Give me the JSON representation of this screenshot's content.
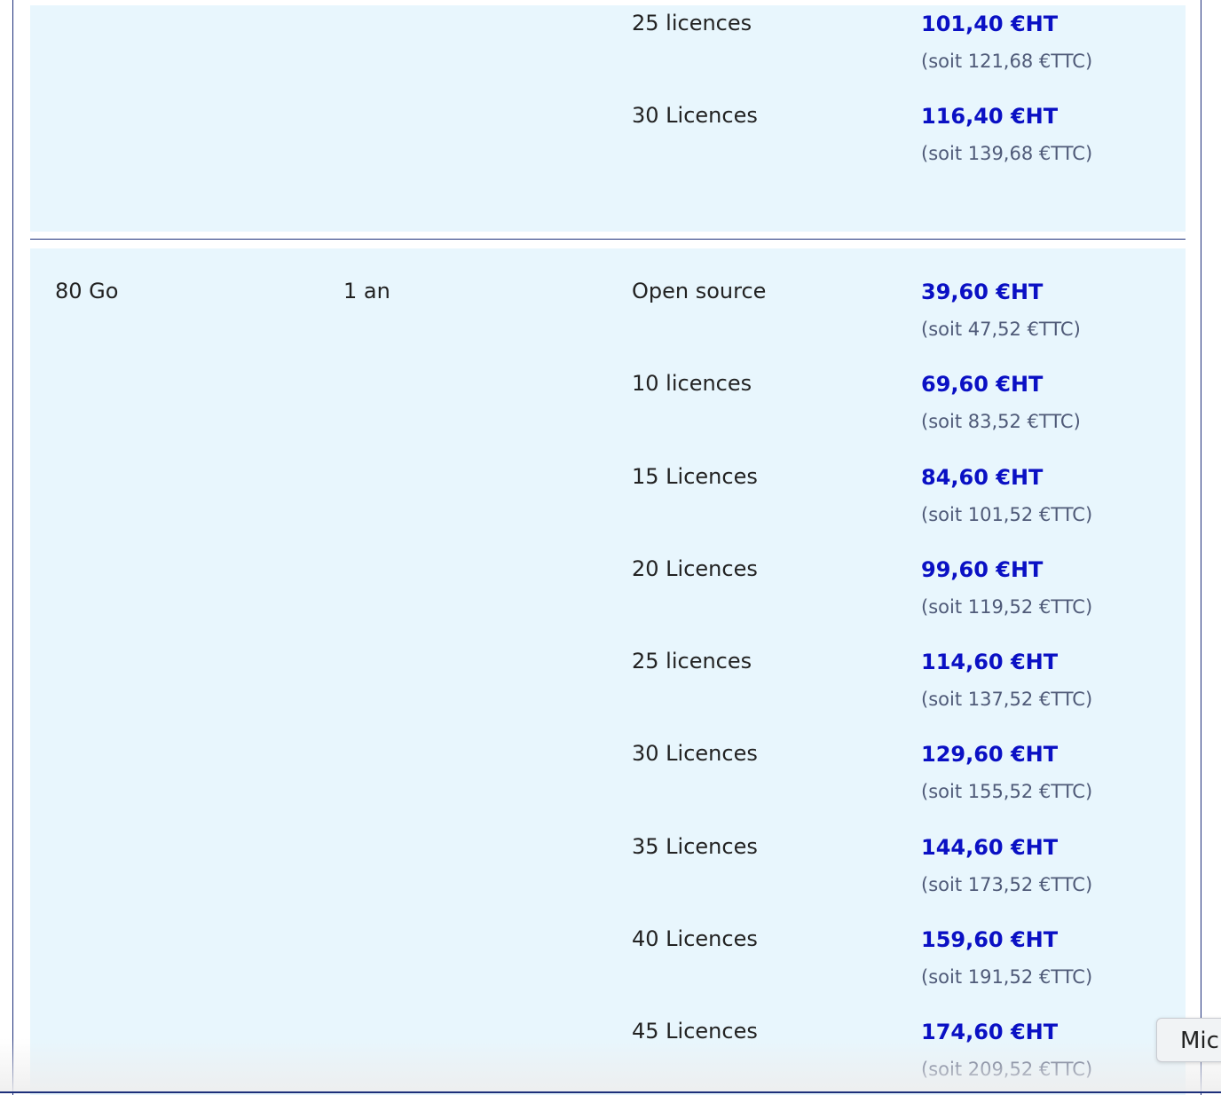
{
  "top_block": {
    "rows": [
      {
        "label": "25 licences",
        "price_ht": "101,40 €HT",
        "price_ttc": "(soit 121,68 €TTC)"
      },
      {
        "label": "30 Licences",
        "price_ht": "116,40 €HT",
        "price_ttc": "(soit 139,68 €TTC)"
      }
    ]
  },
  "main_block": {
    "storage": "80 Go",
    "duration": "1 an",
    "rows": [
      {
        "label": "Open source",
        "price_ht": "39,60 €HT",
        "price_ttc": "(soit 47,52 €TTC)"
      },
      {
        "label": "10 licences",
        "price_ht": "69,60 €HT",
        "price_ttc": "(soit 83,52 €TTC)"
      },
      {
        "label": "15 Licences",
        "price_ht": "84,60 €HT",
        "price_ttc": "(soit 101,52 €TTC)"
      },
      {
        "label": "20 Licences",
        "price_ht": "99,60 €HT",
        "price_ttc": "(soit 119,52 €TTC)"
      },
      {
        "label": "25 licences",
        "price_ht": "114,60 €HT",
        "price_ttc": "(soit 137,52 €TTC)"
      },
      {
        "label": "30 Licences",
        "price_ht": "129,60 €HT",
        "price_ttc": "(soit 155,52 €TTC)"
      },
      {
        "label": "35 Licences",
        "price_ht": "144,60 €HT",
        "price_ttc": "(soit 173,52 €TTC)"
      },
      {
        "label": "40 Licences",
        "price_ht": "159,60 €HT",
        "price_ttc": "(soit 191,52 €TTC)"
      },
      {
        "label": "45 Licences",
        "price_ht": "174,60 €HT",
        "price_ttc": "(soit 209,52 €TTC)"
      }
    ]
  },
  "floating_button": {
    "label": "Mic"
  },
  "colors": {
    "row_background": "#e8f6fd",
    "price_ht": "#0a10c4",
    "price_ttc": "#4f5a78",
    "border": "#1d2f7a"
  }
}
